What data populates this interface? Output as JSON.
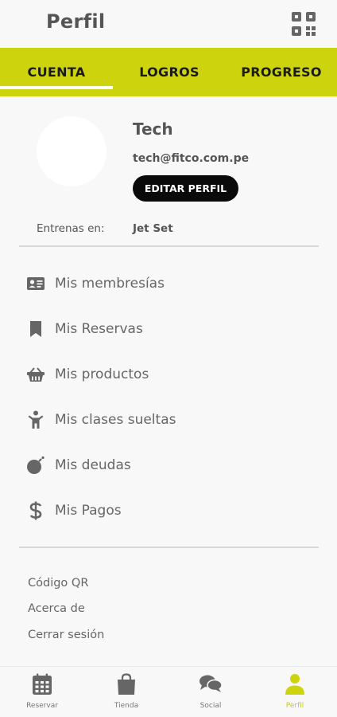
{
  "header": {
    "title": "Perfil",
    "qr_icon": "qr-code-icon"
  },
  "tabs": [
    {
      "label": "CUENTA",
      "active": true
    },
    {
      "label": "LOGROS",
      "active": false
    },
    {
      "label": "PROGRESO",
      "active": false
    }
  ],
  "profile": {
    "name": "Tech",
    "email": "tech@fitco.com.pe",
    "edit_label": "EDITAR PERFIL",
    "trains_label": "Entrenas en:",
    "trains_value": "Jet Set"
  },
  "menu": [
    {
      "label": "Mis membresías",
      "icon": "id-card-icon"
    },
    {
      "label": "Mis Reservas",
      "icon": "bookmark-icon"
    },
    {
      "label": "Mis productos",
      "icon": "basket-icon"
    },
    {
      "label": "Mis clases sueltas",
      "icon": "person-icon"
    },
    {
      "label": "Mis deudas",
      "icon": "bomb-icon"
    },
    {
      "label": "Mis Pagos",
      "icon": "dollar-icon"
    }
  ],
  "links": [
    "Código QR",
    "Acerca de",
    "Cerrar sesión"
  ],
  "bottom_nav": [
    {
      "label": "Reservar",
      "icon": "calendar-icon",
      "active": false
    },
    {
      "label": "Tienda",
      "icon": "shopping-bag-icon",
      "active": false
    },
    {
      "label": "Social",
      "icon": "chat-bubbles-icon",
      "active": false
    },
    {
      "label": "Perfil",
      "icon": "user-icon",
      "active": true
    }
  ],
  "colors": {
    "accent": "#cdd40e",
    "accent_text": "#c7cd10",
    "text": "#555555",
    "button_bg": "#0a0a0a"
  }
}
